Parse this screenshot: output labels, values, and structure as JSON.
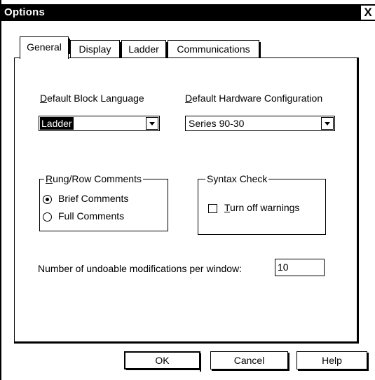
{
  "window": {
    "title": "Options",
    "close_symbol": "X"
  },
  "tabs": [
    {
      "label": "General",
      "active": true
    },
    {
      "label": "Display",
      "active": false
    },
    {
      "label": "Ladder",
      "active": false
    },
    {
      "label": "Communications",
      "active": false
    }
  ],
  "general": {
    "block_language": {
      "label_first": "D",
      "label_rest": "efault Block Language",
      "value": "Ladder"
    },
    "hardware_config": {
      "label_first": "D",
      "label_rest": "efault Hardware Configuration",
      "value": "Series 90-30"
    },
    "rung_comments": {
      "legend_first": "R",
      "legend_rest": "ung/Row Comments",
      "options": [
        {
          "label": "Brief Comments",
          "selected": true
        },
        {
          "label": "Full Comments",
          "selected": false
        }
      ]
    },
    "syntax_check": {
      "legend": "Syntax Check",
      "checkbox_first": "T",
      "checkbox_rest": "urn off warnings",
      "checked": false
    },
    "undo": {
      "label": "Number of undoable modifications per window:",
      "value": "10"
    }
  },
  "buttons": {
    "ok": "OK",
    "cancel": "Cancel",
    "help": "Help"
  }
}
